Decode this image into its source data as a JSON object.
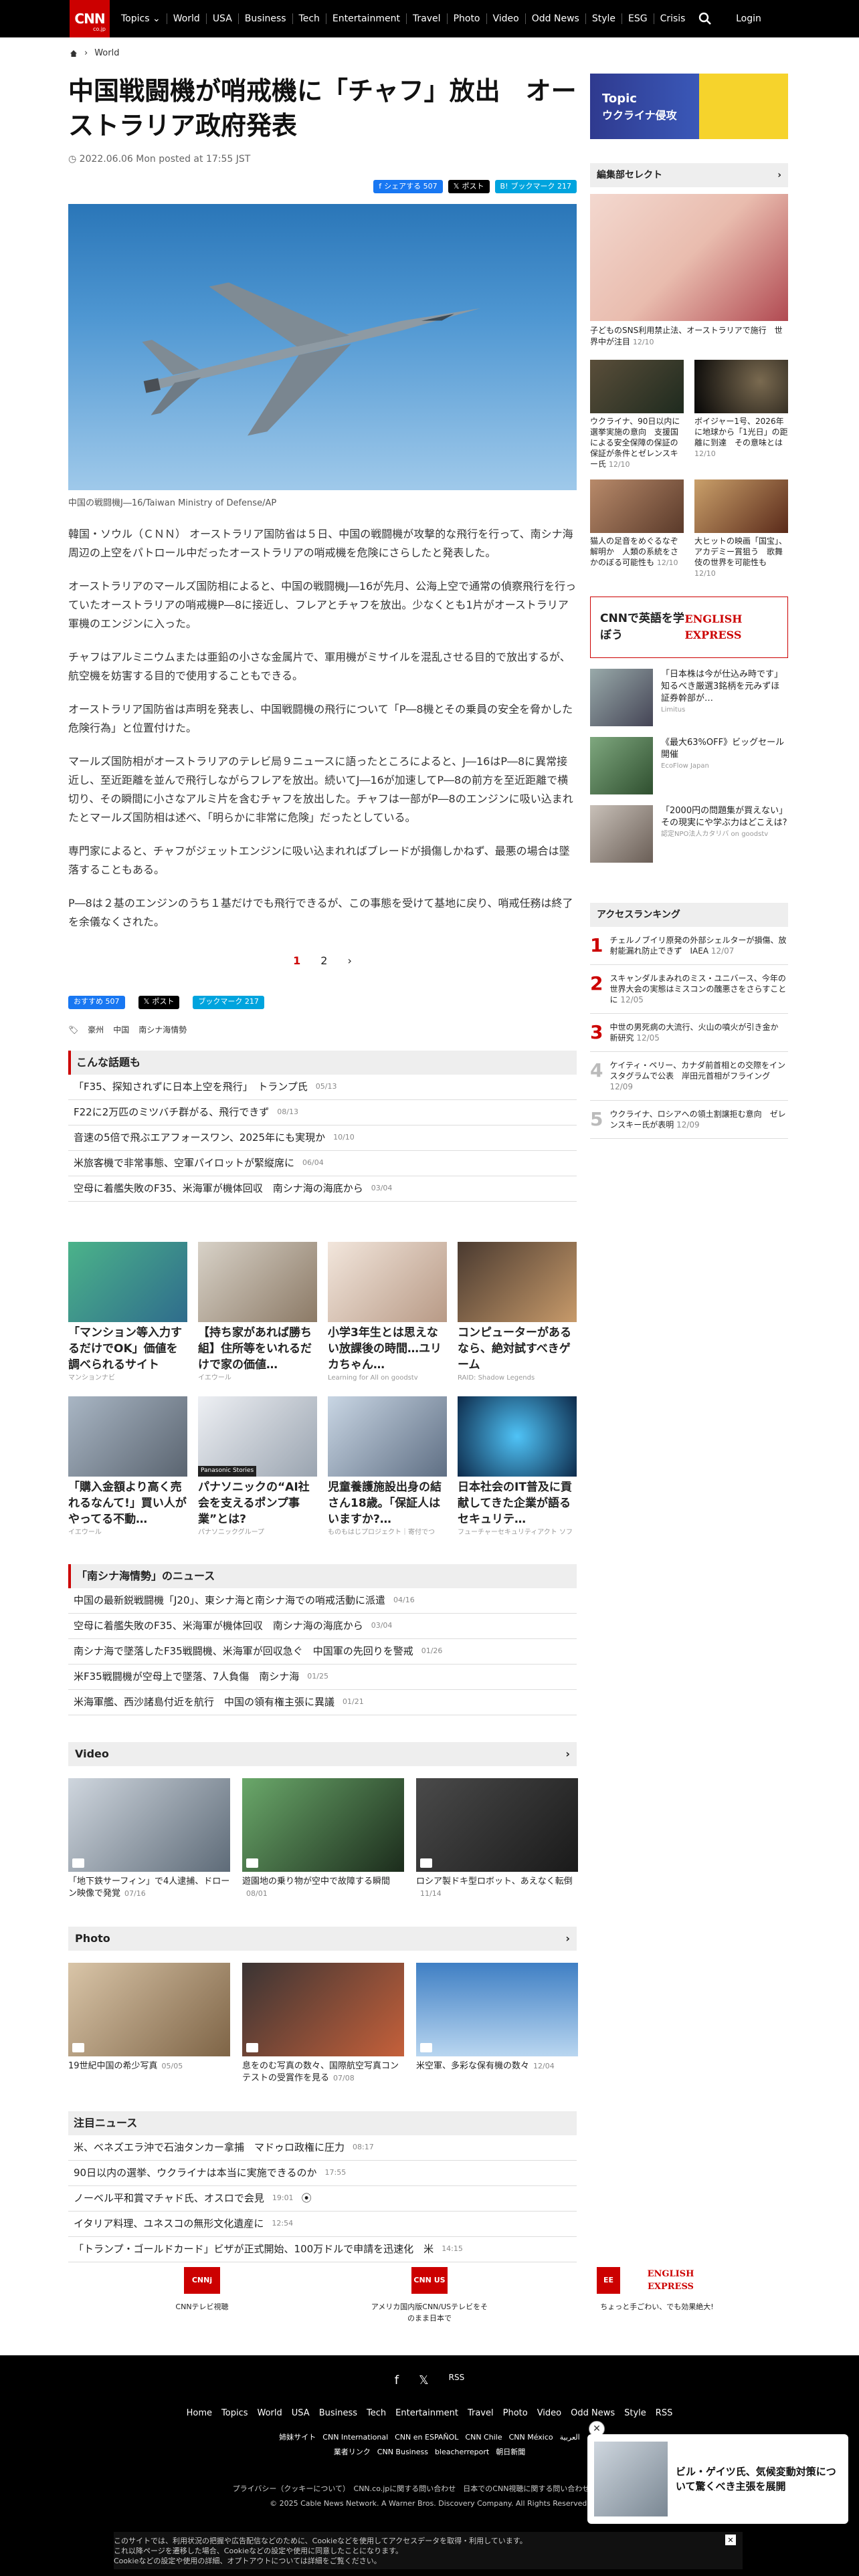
{
  "header": {
    "logo": "CNN",
    "logo_sub": "co.jp",
    "nav": [
      "Topics ⌄",
      "World",
      "USA",
      "Business",
      "Tech",
      "Entertainment",
      "Travel",
      "Photo",
      "Video",
      "Odd News",
      "Style",
      "ESG",
      "Crisis"
    ],
    "login": "Login"
  },
  "breadcrumb": {
    "section": "World"
  },
  "article": {
    "title": "中国戦闘機が哨戒機に「チャフ」放出　オーストラリア政府発表",
    "date": "2022.06.06 Mon posted at 17:55 JST",
    "share": {
      "fb": "シェアする 507",
      "x": "ポスト",
      "hb": "ブックマーク 217"
    },
    "caption": "中国の戦闘機J―16/Taiwan Ministry of Defense/AP",
    "paragraphs": [
      "韓国・ソウル（ＣＮＮ） オーストラリア国防省は５日、中国の戦闘機が攻撃的な飛行を行って、南シナ海周辺の上空をパトロール中だったオーストラリアの哨戒機を危険にさらしたと発表した。",
      "オーストラリアのマールズ国防相によると、中国の戦闘機J―16が先月、公海上空で通常の偵察飛行を行っていたオーストラリアの哨戒機P―8に接近し、フレアとチャフを放出。少なくとも1片がオーストラリア軍機のエンジンに入った。",
      "チャフはアルミニウムまたは亜鉛の小さな金属片で、軍用機がミサイルを混乱させる目的で放出するが、航空機を妨害する目的で使用することもできる。",
      "オーストラリア国防省は声明を発表し、中国戦闘機の飛行について「P―8機とその乗員の安全を脅かした危険行為」と位置付けた。",
      "マールズ国防相がオーストラリアのテレビ局９ニュースに語ったところによると、J―16はP―8に異常接近し、至近距離を並んで飛行しながらフレアを放出。続いてJ―16が加速してP―8の前方を至近距離で横切り、その瞬間に小さなアルミ片を含むチャフを放出した。チャフは一部がP―8のエンジンに吸い込まれたとマールズ国防相は述べ、「明らかに非常に危険」だったとしている。",
      "専門家によると、チャフがジェットエンジンに吸い込まれればブレードが損傷しかねず、最悪の場合は墜落することもある。",
      "P―8は２基のエンジンのうち１基だけでも飛行できるが、この事態を受けて基地に戻り、哨戒任務は終了を余儀なくされた。"
    ],
    "pager": [
      "1",
      "2",
      "›"
    ],
    "share2": {
      "fb": "おすすめ 507",
      "x": "ポスト",
      "hb": "ブックマーク 217"
    },
    "tags": [
      "豪州",
      "中国",
      "南シナ海情勢"
    ]
  },
  "konna": {
    "title": "こんな話題も",
    "items": [
      {
        "t": "「F35、探知されずに日本上空を飛行」　トランプ氏",
        "d": "05/13"
      },
      {
        "t": "F22に2万匹のミツバチ群がる、飛行できず",
        "d": "08/13"
      },
      {
        "t": "音速の5倍で飛ぶエアフォースワン、2025年にも実現か",
        "d": "10/10"
      },
      {
        "t": "米旅客機で非常事態、空軍パイロットが緊縦席に",
        "d": "06/04"
      },
      {
        "t": "空母に着艦失敗のF35、米海軍が機体回収　南シナ海の海底から",
        "d": "03/04"
      }
    ]
  },
  "ads": [
    {
      "t": "「マンション等入力するだけでOK」価値を調べられるサイト",
      "s": "マンションナビ"
    },
    {
      "t": "【持ち家があれば勝ち組】住所等をいれるだけで家の価値…",
      "s": "イエウール"
    },
    {
      "t": "小学3年生とは思えない放課後の時間…ユリカちゃん…",
      "s": "Learning for All on goodstv"
    },
    {
      "t": "コンピューターがあるなら、絶対試すべきゲーム",
      "s": "RAID: Shadow Legends"
    },
    {
      "t": "「購入金額より高く売れるなんて!」買い人がやってる不動…",
      "s": "イエウール"
    },
    {
      "t": "パナソニックの“AI社会を支えるポンプ事業”とは?",
      "s": "パナソニックグループ"
    },
    {
      "t": "児童養護施設出身の結さん18歳。「保証人はいますか?…",
      "s": "ものもはじプロジェクト｜寄付でつ"
    },
    {
      "t": "日本社会のIT普及に貢献してきた企業が語るセキュリテ…",
      "s": "フューチャーセキュリティアクト ソフ"
    }
  ],
  "ads_badge": "Panasonic Stories",
  "nanshina": {
    "title": "「南シナ海情勢」のニュース",
    "items": [
      {
        "t": "中国の最新鋭戦闘機「J20」、東シナ海と南シナ海での哨戒活動に派遣",
        "d": "04/16"
      },
      {
        "t": "空母に着艦失敗のF35、米海軍が機体回収　南シナ海の海底から",
        "d": "03/04"
      },
      {
        "t": "南シナ海で墜落したF35戦闘機、米海軍が回収急ぐ　中国軍の先回りを警戒",
        "d": "01/26"
      },
      {
        "t": "米F35戦闘機が空母上で墜落、7人負傷　南シナ海",
        "d": "01/25"
      },
      {
        "t": "米海軍艦、西沙諸島付近を航行　中国の領有権主張に異議",
        "d": "01/21"
      }
    ]
  },
  "video": {
    "title": "Video",
    "items": [
      {
        "t": "「地下鉄サーフィン」で4人逮捕、ドローン映像で発覚",
        "d": "07/16"
      },
      {
        "t": "遊園地の乗り物が空中で故障する瞬間",
        "d": "08/01"
      },
      {
        "t": "ロシア製ドキ型ロボット、あえなく転倒",
        "d": "11/14"
      }
    ]
  },
  "photo": {
    "title": "Photo",
    "items": [
      {
        "t": "19世紀中国の希少写真",
        "d": "05/05"
      },
      {
        "t": "息をのむ写真の数々、国際航空写真コンテストの受賞作を見る",
        "d": "07/08"
      },
      {
        "t": "米空軍、多彩な保有機の数々",
        "d": "12/04"
      }
    ]
  },
  "chumoku": {
    "title": "注目ニュース",
    "items": [
      {
        "t": "米、ベネズエラ沖で石油タンカー拿捕　マドゥロ政権に圧力",
        "d": "08:17"
      },
      {
        "t": "90日以内の選挙、ウクライナは本当に実施できるのか",
        "d": "17:55"
      },
      {
        "t": "ノーベル平和賞マチャド氏、オスロで会見",
        "d": "19:01"
      },
      {
        "t": "イタリア料理、ユネスコの無形文化遺産に",
        "d": "12:54"
      },
      {
        "t": "「トランプ・ゴールドカード」ビザが正式開始、100万ドルで申請を迅速化　米",
        "d": "14:15"
      }
    ]
  },
  "sidebar": {
    "topic_label": "Topic",
    "topic_title": "ウクライナ侵攻",
    "editor_title": "編集部セレクト",
    "big_caption": "子どものSNS利用禁止法、オーストラリアで施行　世界中が注目",
    "big_date": "12/10",
    "grid": [
      {
        "t": "ウクライナ、90日以内に選挙実施の意向　支援国による安全保障の保証の保証が条件とゼレンスキー氏",
        "d": "12/10"
      },
      {
        "t": "ボイジャー1号、2026年に地球から「1光日」の距離に到達　その意味とは",
        "d": "12/10"
      },
      {
        "t": "猫人の足音をめぐるなぞ解明か　人類の系統をさかのぼる可能性も",
        "d": "12/10"
      },
      {
        "t": "大ヒットの映画「国宝」、アカデミー賞狙う　歌舞伎の世界を可能性も",
        "d": "12/10"
      }
    ],
    "cnn_eng_text": "CNNで英語を学ぼう",
    "cnn_eng_logo": "ENGLISH EXPRESS",
    "sponsored": [
      {
        "t": "「日本株は今が仕込み時です」知るべき厳選3銘柄を元みずほ証券幹部が…",
        "s": "Limitus"
      },
      {
        "t": "《最大63%OFF》ビッグセール開催",
        "s": "EcoFlow Japan"
      },
      {
        "t": "「2000円の問題集が買えない」その現実にや学ぶ力はどこえは?",
        "s": "認定NPO法人カタリバ on goodstv"
      }
    ],
    "rank_title": "アクセスランキング",
    "ranks": [
      {
        "n": "1",
        "t": "チェルノブイリ原発の外部シェルターが損傷、放射能漏れ防止できず　IAEA",
        "d": "12/07"
      },
      {
        "n": "2",
        "t": "スキャンダルまみれのミス・ユニバース、今年の世界大会の実態はミスコンの醜悪さをさらすことに",
        "d": "12/05"
      },
      {
        "n": "3",
        "t": "中世の男死病の大流行、火山の噴火が引き金か　新研究",
        "d": "12/05"
      },
      {
        "n": "4",
        "t": "ケイティ・ペリー、カナダ前首相との交際をインスタグラムで公表　岸田元首相がフライング",
        "d": "12/09"
      },
      {
        "n": "5",
        "t": "ウクライナ、ロシアへの領土割譲拒む意向　ゼレンスキー氏が表明",
        "d": "12/09"
      }
    ]
  },
  "brands": [
    {
      "lg": "CNNj",
      "t": "CNNテレビ視聴"
    },
    {
      "lg": "CNN US",
      "t": "アメリカ国内版CNN/USテレビをそのまま日本で"
    },
    {
      "lg": "EE",
      "t": "ちょっと手ごわい、でも効果絶大!"
    }
  ],
  "brand3_name": "ENGLISH EXPRESS",
  "footer": {
    "social": [
      "f",
      "𝕏",
      "RSS"
    ],
    "links": [
      "Home",
      "Topics",
      "World",
      "USA",
      "Business",
      "Tech",
      "Entertainment",
      "Travel",
      "Photo",
      "Video",
      "Odd News",
      "Style",
      "RSS"
    ],
    "links2": [
      "姉妹サイト",
      "CNN International",
      "CNN en ESPAÑOL",
      "CNN Chile",
      "CNN México",
      "العربية"
    ],
    "links3": [
      "業者リンク",
      "CNN Business",
      "bleacherreport",
      "朝日新聞"
    ],
    "policy": "プライバシー（クッキーについて）　CNN.co.jpに関する問い合わせ　日本でのCNN視聴に関する問い合わせ　広告掲載",
    "copyright": "© 2025 Cable News Network. A Warner Bros. Discovery Company. All Rights Reserved."
  },
  "cookie": {
    "text1": "このサイトでは、利用状況の把握や広告配信などのために、Cookieなどを使用してアクセスデータを取得・利用しています。",
    "text2": "これ以降ページを遷移した場合、Cookieなどの設定や使用に同意したことになります。",
    "text3": "Cookieなどの設定や使用の詳細、オプトアウトについては詳細をご覧ください。"
  },
  "popup": {
    "title": "ビル・ゲイツ氏、気候変動対策について驚くべき主張を展開"
  }
}
